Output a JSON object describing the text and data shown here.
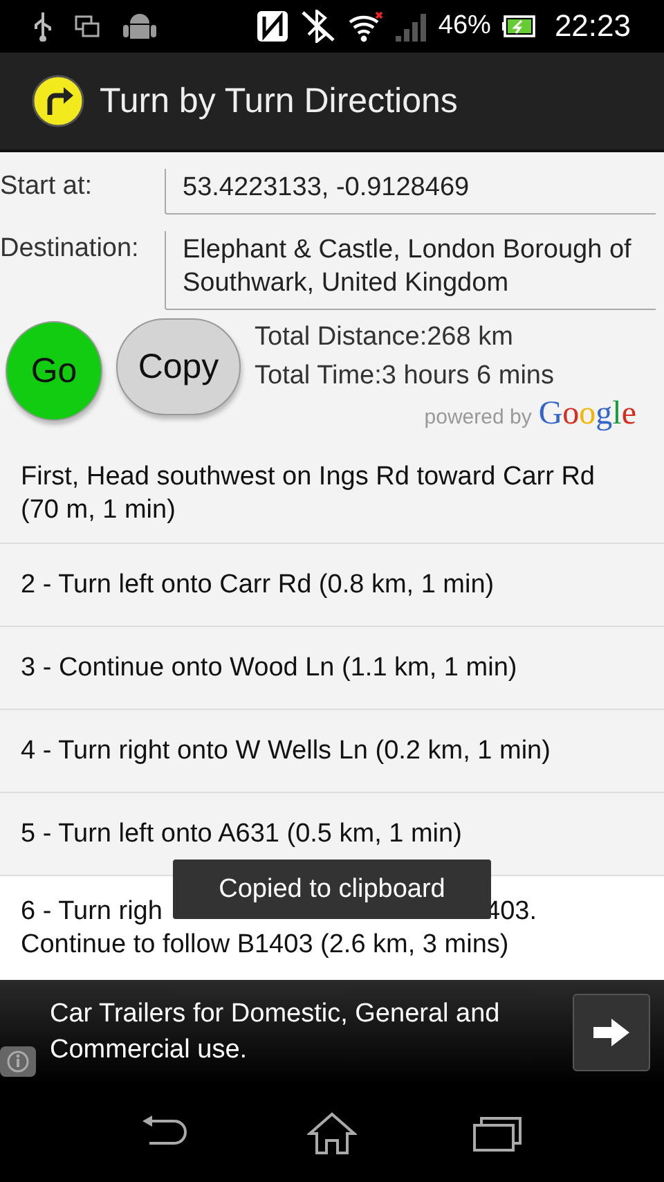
{
  "status_bar": {
    "battery": "46%",
    "time": "22:23"
  },
  "app_bar": {
    "title": "Turn by Turn Directions"
  },
  "form": [
    {
      "label": "Start at:",
      "value": "53.4223133, -0.9128469"
    },
    {
      "label": "Destination:",
      "value": "Elephant & Castle, London Borough of Southwark, United Kingdom"
    }
  ],
  "buttons": [
    {
      "kind": "go",
      "label": "Go"
    },
    {
      "kind": "copy",
      "label": "Copy"
    }
  ],
  "totals": [
    "Total Distance:268 km",
    "Total Time:3 hours 6 mins"
  ],
  "attribution": {
    "prefix": "powered by",
    "brand": "Google"
  },
  "directions": [
    {
      "lines": [
        [
          "First, Head southwest on Ings Rd toward Carr Rd (70 m, 1 min)"
        ]
      ]
    },
    {
      "lines": [
        [
          "2 - Turn left onto Carr Rd (0.8 km, 1 min)"
        ]
      ]
    },
    {
      "lines": [
        [
          "3 - Continue onto Wood Ln (1.1 km, 1 min)"
        ]
      ]
    },
    {
      "lines": [
        [
          "4 - Turn right onto W Wells Ln (0.2 km, 1 min)"
        ]
      ]
    },
    {
      "lines": [
        [
          "5 - Turn left onto A631 (0.5 km, 1 min)"
        ]
      ]
    },
    {
      "lines": [
        [
          "6 - Turn righ",
          "403."
        ],
        [
          "Continue to follow B1403 (2.6 km, 3 mins)"
        ]
      ]
    }
  ],
  "toast": "Copied to clipboard",
  "ad": {
    "text": "Car Trailers for Domestic, General and Commercial use."
  }
}
